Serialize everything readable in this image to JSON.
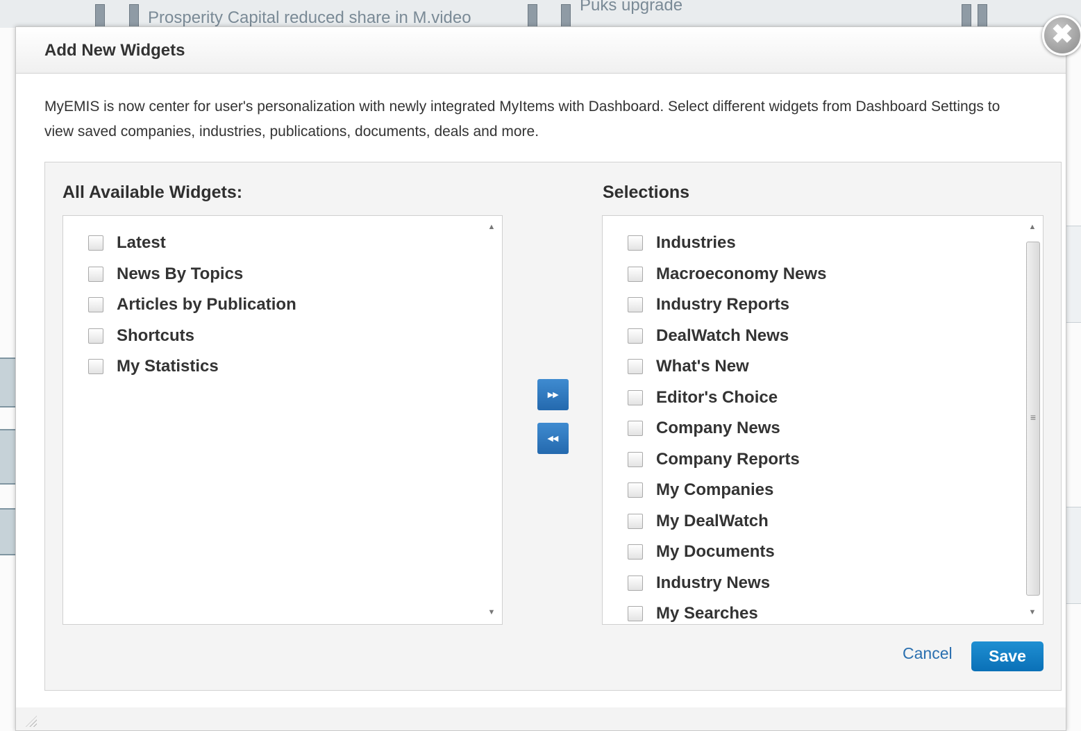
{
  "background": {
    "headline_left": "Prosperity Capital reduced share in M.video",
    "headline_right": "Puks upgrade"
  },
  "dialog": {
    "title": "Add New Widgets",
    "close_glyph": "✖",
    "intro": "MyEMIS is now center for user's personalization with newly integrated MyItems with Dashboard. Select different widgets from Dashboard Settings to view saved companies, industries, publications, documents, deals and more."
  },
  "available": {
    "heading": "All Available Widgets:",
    "items": [
      {
        "label": "Latest",
        "checked": false
      },
      {
        "label": "News By Topics",
        "checked": false
      },
      {
        "label": "Articles by Publication",
        "checked": false
      },
      {
        "label": "Shortcuts",
        "checked": false
      },
      {
        "label": "My Statistics",
        "checked": false
      }
    ]
  },
  "selections": {
    "heading": "Selections",
    "items": [
      {
        "label": "Industries",
        "checked": false
      },
      {
        "label": "Macroeconomy News",
        "checked": false
      },
      {
        "label": "Industry Reports",
        "checked": false
      },
      {
        "label": "DealWatch News",
        "checked": false
      },
      {
        "label": "What's New",
        "checked": false
      },
      {
        "label": "Editor's Choice",
        "checked": false
      },
      {
        "label": "Company News",
        "checked": false
      },
      {
        "label": "Company Reports",
        "checked": false
      },
      {
        "label": "My Companies",
        "checked": false
      },
      {
        "label": "My DealWatch",
        "checked": false
      },
      {
        "label": "My Documents",
        "checked": false
      },
      {
        "label": "Industry News",
        "checked": false
      },
      {
        "label": "My Searches",
        "checked": false
      }
    ]
  },
  "transfer": {
    "add_glyph": "▸▸",
    "remove_glyph": "◂◂"
  },
  "actions": {
    "cancel_label": "Cancel",
    "save_label": "Save"
  },
  "colors": {
    "accent": "#0a70b7",
    "move_button": "#2f7bc2",
    "link": "#2a6faf"
  }
}
